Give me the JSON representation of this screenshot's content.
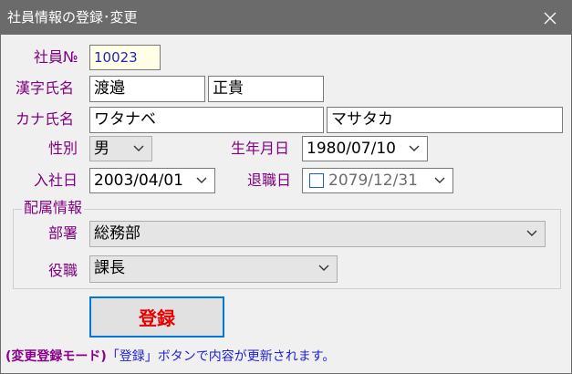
{
  "window": {
    "title": "社員情報の登録･変更"
  },
  "employee_no": {
    "label": "社員№",
    "value": "10023"
  },
  "kanji_name": {
    "label": "漢字氏名",
    "last": "渡邉",
    "first": "正貴"
  },
  "kana_name": {
    "label": "カナ氏名",
    "last": "ワタナベ",
    "first": "マサタカ"
  },
  "gender": {
    "label": "性別",
    "value": "男"
  },
  "birth_date": {
    "label": "生年月日",
    "value": "1980/07/10"
  },
  "hire_date": {
    "label": "入社日",
    "value": "2003/04/01"
  },
  "retire_date": {
    "label": "退職日",
    "value": "2079/12/31",
    "checked": false
  },
  "assignment": {
    "title": "配属情報",
    "department": {
      "label": "部署",
      "value": "総務部"
    },
    "position": {
      "label": "役職",
      "value": "課長"
    }
  },
  "register_button": {
    "label": "登録"
  },
  "status": {
    "mode": "(変更登録モード)",
    "message": "「登録」ボタンで内容が更新されます。"
  },
  "colors": {
    "label_purple": "#800080",
    "accent_blue": "#0078d7",
    "button_red": "#e60000",
    "titlebar": "#6b6b6b"
  }
}
